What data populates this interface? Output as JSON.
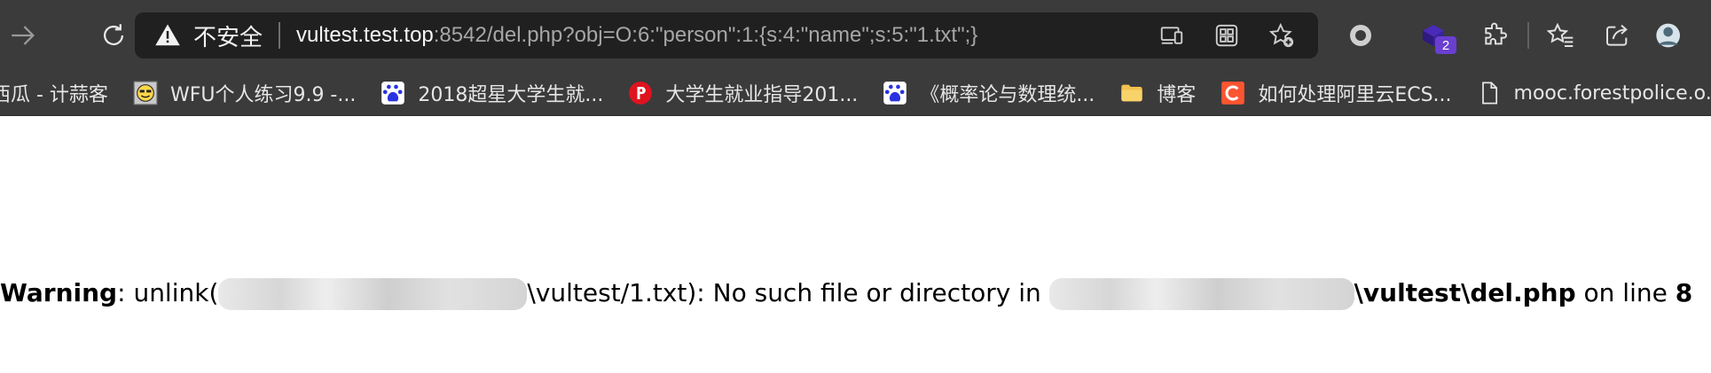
{
  "toolbar": {
    "address": {
      "security_label": "不安全",
      "url_host": "vultest.test.top",
      "url_rest": ":8542/del.php?obj=O:6:\"person\":1:{s:4:\"name\";s:5:\"1.txt\";}"
    },
    "extensions_badge": "2"
  },
  "bookmarks": [
    {
      "label": "西瓜 - 计蒜客",
      "icon": "jisuanke-icon"
    },
    {
      "label": "WFU个人练习9.9 -...",
      "icon": "smiley-icon"
    },
    {
      "label": "2018超星大学生就...",
      "icon": "baidu-icon"
    },
    {
      "label": "大学生就业指导201...",
      "icon": "p-icon"
    },
    {
      "label": "《概率论与数理统...",
      "icon": "baidu-icon"
    },
    {
      "label": "博客",
      "icon": "folder-icon"
    },
    {
      "label": "如何处理阿里云ECS...",
      "icon": "c-icon"
    },
    {
      "label": "mooc.forestpolice.o...",
      "icon": "page-icon"
    }
  ],
  "page": {
    "warning_word": "Warning",
    "text_1": ": unlink(",
    "text_2": "\\vultest/1.txt): No such file or directory in ",
    "file_path": "\\vultest\\del.php",
    "text_3": " on line ",
    "line_number": "8"
  },
  "colors": {
    "chrome_bg": "#3b3b3b",
    "address_bg": "#202020",
    "badge": "#6a3fcf"
  }
}
